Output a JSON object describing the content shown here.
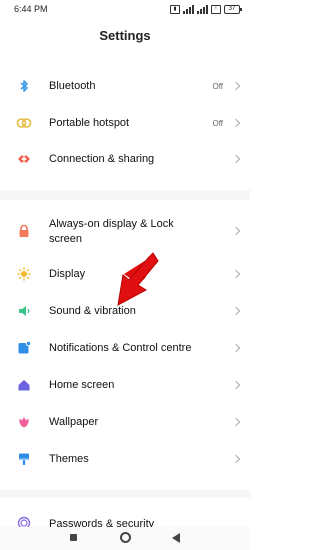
{
  "status": {
    "time": "6:44 PM",
    "battery": "37"
  },
  "header": {
    "title": "Settings"
  },
  "rows": [
    {
      "id": "bluetooth",
      "label": "Bluetooth",
      "value": "Off"
    },
    {
      "id": "hotspot",
      "label": "Portable hotspot",
      "value": "Off"
    },
    {
      "id": "connection",
      "label": "Connection & sharing",
      "value": ""
    },
    {
      "id": "aod",
      "label": "Always-on display & Lock\nscreen",
      "value": ""
    },
    {
      "id": "display",
      "label": "Display",
      "value": ""
    },
    {
      "id": "sound",
      "label": "Sound & vibration",
      "value": ""
    },
    {
      "id": "notifications",
      "label": "Notifications & Control centre",
      "value": ""
    },
    {
      "id": "home",
      "label": "Home screen",
      "value": ""
    },
    {
      "id": "wallpaper",
      "label": "Wallpaper",
      "value": ""
    },
    {
      "id": "themes",
      "label": "Themes",
      "value": ""
    },
    {
      "id": "passwords",
      "label": "Passwords & security",
      "value": ""
    }
  ],
  "colors": {
    "bluetooth": "#3a9be8",
    "hotspot": "#e6b93a",
    "connection": "#f05a4a",
    "lock": "#f07a5a",
    "display": "#f5b82e",
    "sound": "#3cc48a",
    "notifications": "#2f8fe6",
    "home": "#6a63e0",
    "wallpaper": "#f0609a",
    "themes": "#2f8fe6",
    "passwords": "#8a6ae6",
    "annotation_arrow": "#e01010"
  }
}
